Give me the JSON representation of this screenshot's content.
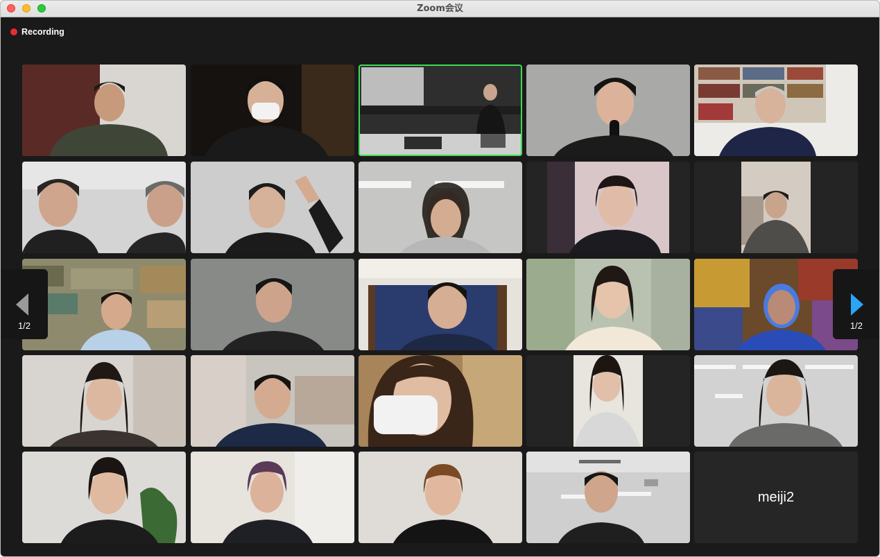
{
  "window": {
    "title": "Zoom会议"
  },
  "status": {
    "recording_label": "Recording",
    "recording_color": "#ee2b2b"
  },
  "gallery": {
    "active_speaker_color": "#3ddc54",
    "page_indicator": "1/2",
    "camera_off_participant": "meiji2"
  },
  "navigation": {
    "prev_icon": "chevron-left-icon",
    "next_icon": "chevron-right-icon",
    "next_color": "#2aa6f5"
  }
}
